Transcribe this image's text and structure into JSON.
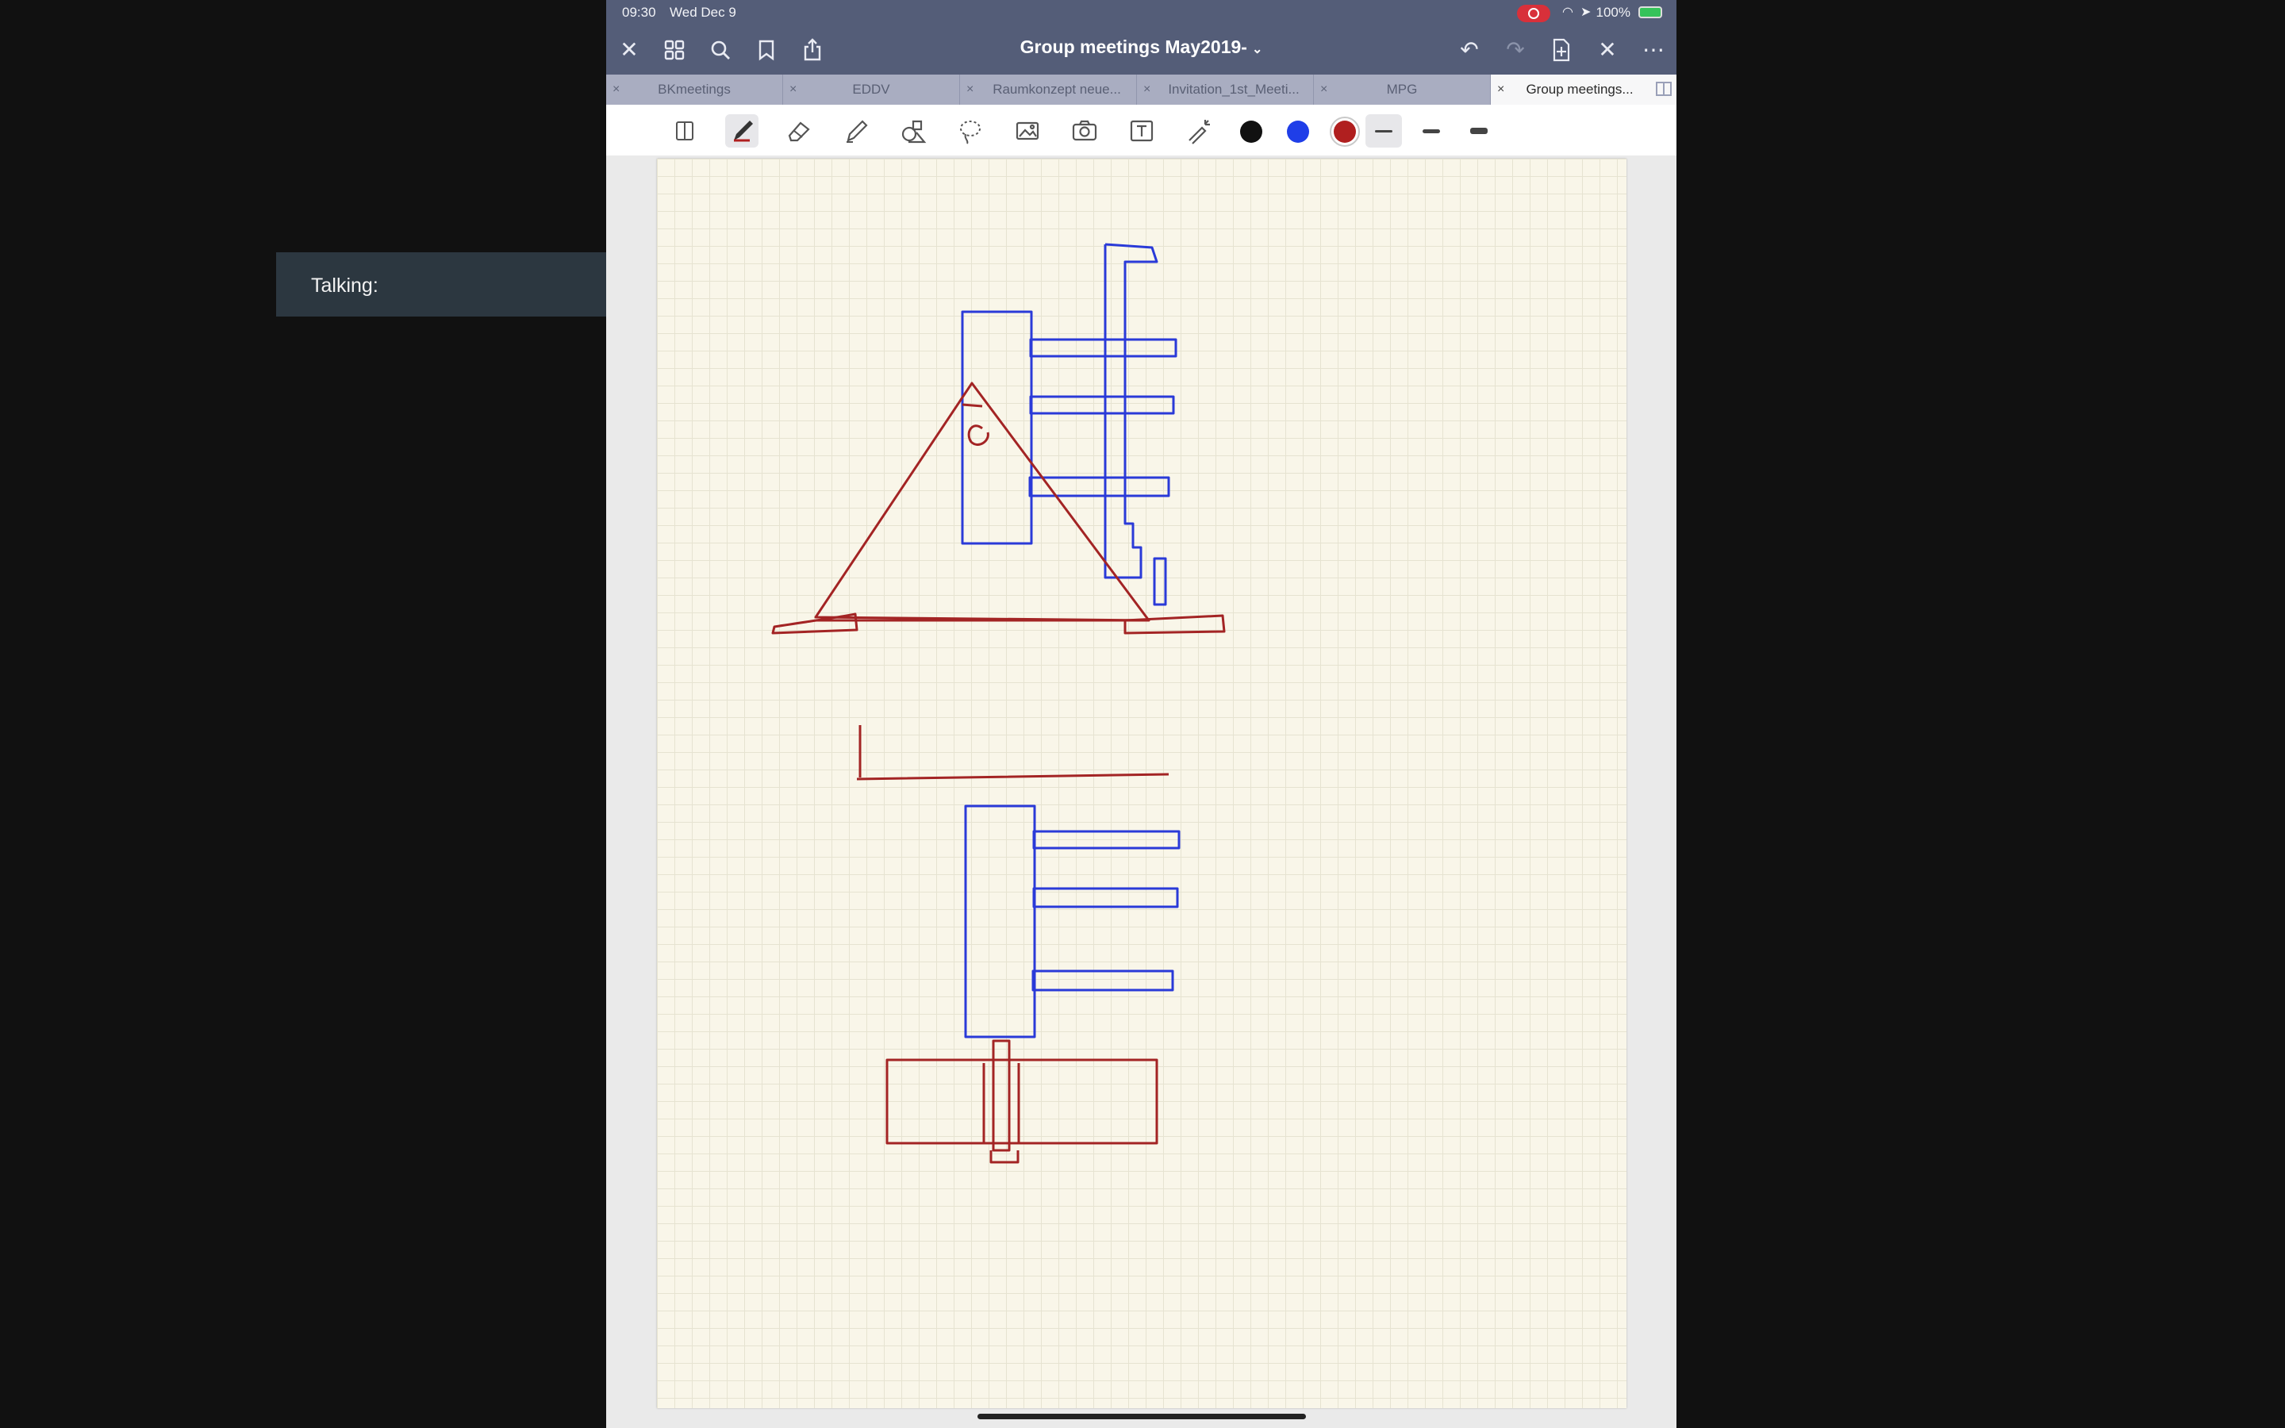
{
  "status_bar": {
    "time": "09:30",
    "date": "Wed Dec 9",
    "battery": "100%"
  },
  "nav_bar": {
    "title": "Group meetings May2019-"
  },
  "tabs": [
    {
      "label": "BKmeetings",
      "active": false
    },
    {
      "label": "EDDV",
      "active": false
    },
    {
      "label": "Raumkonzept neue...",
      "active": false
    },
    {
      "label": "Invitation_1st_Meeti...",
      "active": false
    },
    {
      "label": "MPG",
      "active": false
    },
    {
      "label": "Group meetings...",
      "active": true
    }
  ],
  "toolbar": {
    "tools": [
      "text-mode-icon",
      "pen-icon",
      "eraser-icon",
      "highlighter-icon",
      "shapes-icon",
      "lasso-icon",
      "image-icon",
      "camera-icon",
      "textbox-icon",
      "laser-pointer-icon"
    ],
    "active_tool": "pen-icon",
    "colors": [
      "#111111",
      "#1f3ee8",
      "#b01f1f"
    ],
    "selected_color": "#b01f1f"
  },
  "overlay": {
    "talking_label": "Talking:"
  },
  "drawing_colors": {
    "red_ink": "#a32424",
    "blue_ink": "#2a3ad8"
  }
}
